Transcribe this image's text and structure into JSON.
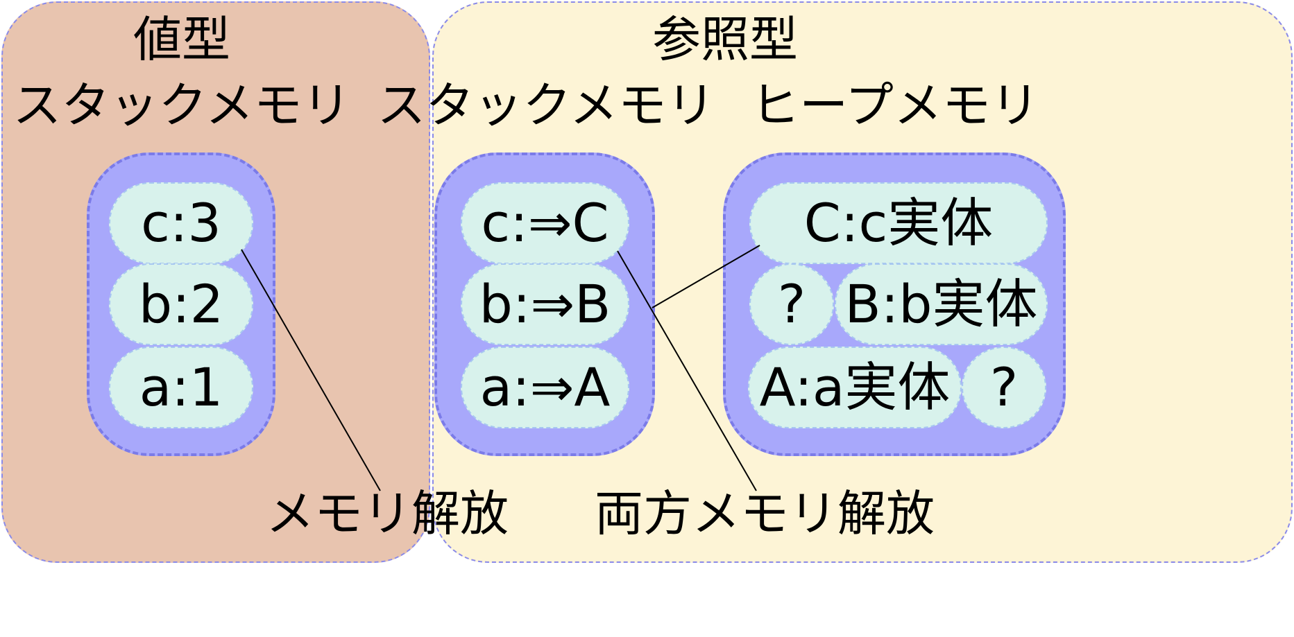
{
  "value_type": {
    "title": "値型",
    "stack_label": "スタックメモリ",
    "stack_items": [
      "c:3",
      "b:2",
      "a:1"
    ]
  },
  "reference_type": {
    "title": "参照型",
    "stack_label": "スタックメモリ",
    "heap_label": "ヒープメモリ",
    "stack_items": [
      "c:⇒C",
      "b:⇒B",
      "a:⇒A"
    ],
    "heap_items": {
      "row1": "C:c実体",
      "row2_left": "?",
      "row2_right": "B:b実体",
      "row3_left": "A:a実体",
      "row3_right": "?"
    }
  },
  "captions": {
    "value_release": "メモリ解放",
    "both_release": "両方メモリ解放"
  },
  "colors": {
    "value_panel": "#e8c4af",
    "reference_panel": "#fdf4d6",
    "memory_box": "#a8a8fb",
    "item_pill": "#d8f2ec",
    "dashed_border": "#8a8ae8"
  }
}
